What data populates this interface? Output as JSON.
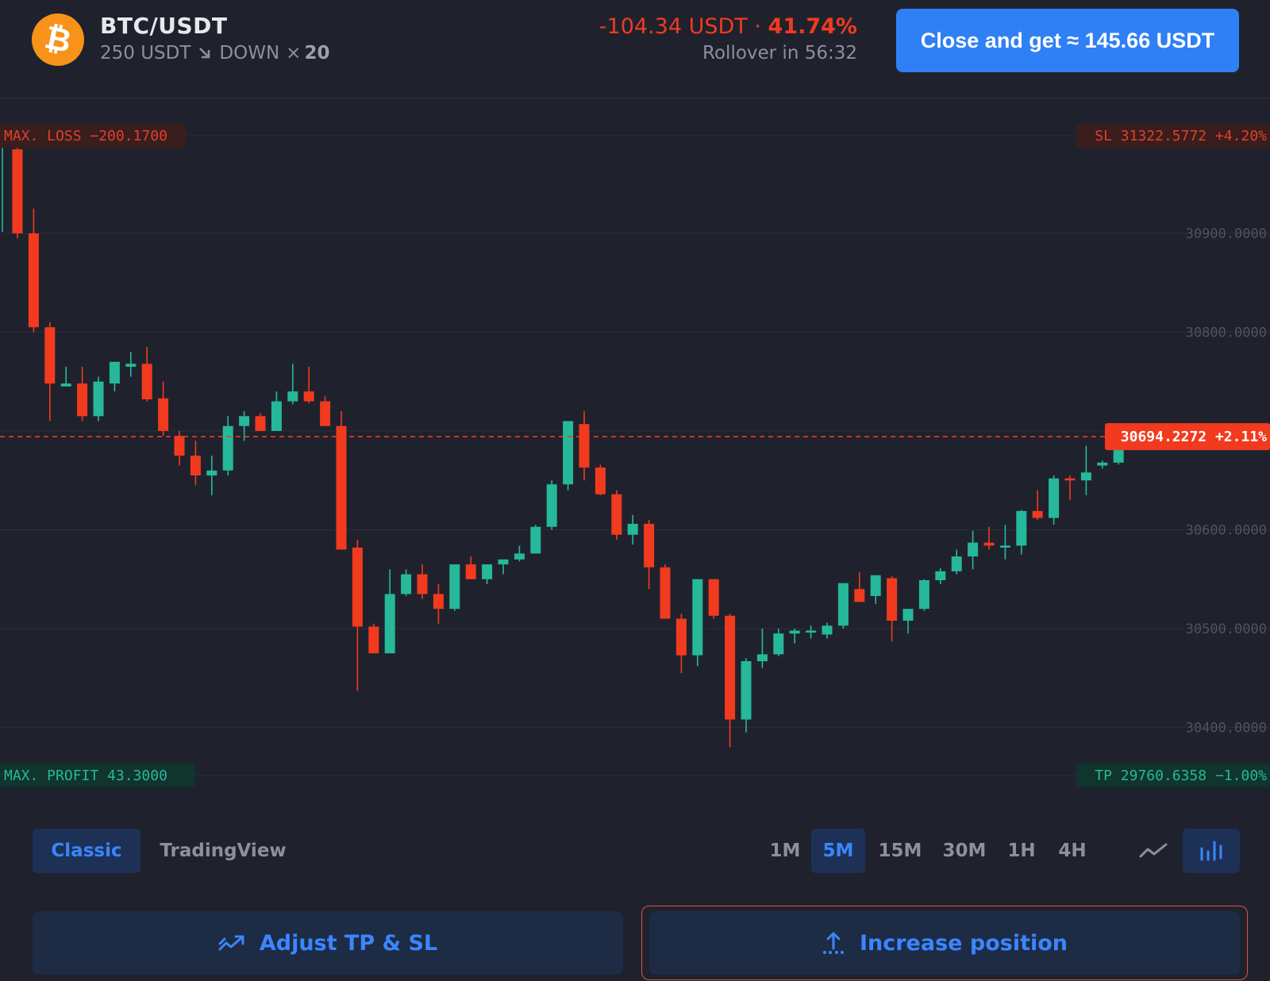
{
  "header": {
    "pair": "BTC/USDT",
    "amount": "250 USDT",
    "direction": "DOWN",
    "multiplier_symbol": "×",
    "multiplier": "20",
    "pnl_value": "-104.34 USDT",
    "pnl_sep": " · ",
    "pnl_percent": "41.74%",
    "rollover": "Rollover in 56:32",
    "close_button": "Close and get ≈ 145.66 USDT",
    "coin_icon": "bitcoin-icon",
    "coin_glyph": "₿"
  },
  "chart_labels": {
    "max_loss": "MAX. LOSS −200.1700",
    "max_profit": "MAX. PROFIT 43.3000",
    "sl": "SL 31322.5772 +4.20%",
    "tp": "TP 29760.6358 −1.00%",
    "current_price": "30694.2272 +2.11%"
  },
  "chart_data": {
    "type": "candlestick",
    "current_price": 30694.2272,
    "yticks": [
      30900,
      30800,
      30600,
      30500,
      30400
    ],
    "ytick_labels": [
      "30900.0000",
      "30800.0000",
      "30600.0000",
      "30500.0000",
      "30400.0000"
    ],
    "ylim": [
      30365,
      31000
    ],
    "candles": [
      [
        30985,
        30990,
        30895,
        30900
      ],
      [
        30900,
        30925,
        30800,
        30805
      ],
      [
        30805,
        30810,
        30710,
        30748
      ],
      [
        30745,
        30765,
        30745,
        30748
      ],
      [
        30748,
        30765,
        30710,
        30715
      ],
      [
        30715,
        30755,
        30710,
        30750
      ],
      [
        30748,
        30770,
        30740,
        30770
      ],
      [
        30765,
        30780,
        30755,
        30768
      ],
      [
        30768,
        30785,
        30730,
        30732
      ],
      [
        30733,
        30750,
        30695,
        30700
      ],
      [
        30695,
        30700,
        30665,
        30675
      ],
      [
        30675,
        30690,
        30645,
        30655
      ],
      [
        30655,
        30675,
        30635,
        30660
      ],
      [
        30660,
        30715,
        30655,
        30705
      ],
      [
        30705,
        30720,
        30690,
        30715
      ],
      [
        30715,
        30718,
        30700,
        30700
      ],
      [
        30700,
        30740,
        30700,
        30730
      ],
      [
        30730,
        30768,
        30727,
        30740
      ],
      [
        30740,
        30765,
        30728,
        30730
      ],
      [
        30730,
        30735,
        30705,
        30705
      ],
      [
        30705,
        30720,
        30580,
        30580
      ],
      [
        30582,
        30590,
        30437,
        30502
      ],
      [
        30502,
        30505,
        30475,
        30475
      ],
      [
        30475,
        30560,
        30475,
        30535
      ],
      [
        30535,
        30560,
        30533,
        30555
      ],
      [
        30555,
        30565,
        30530,
        30535
      ],
      [
        30535,
        30545,
        30505,
        30520
      ],
      [
        30520,
        30565,
        30518,
        30565
      ],
      [
        30565,
        30573,
        30550,
        30550
      ],
      [
        30550,
        30565,
        30545,
        30565
      ],
      [
        30565,
        30570,
        30555,
        30570
      ],
      [
        30570,
        30584,
        30568,
        30576
      ],
      [
        30576,
        30605,
        30576,
        30603
      ],
      [
        30603,
        30650,
        30600,
        30646
      ],
      [
        30646,
        30710,
        30640,
        30710
      ],
      [
        30707,
        30720,
        30650,
        30663
      ],
      [
        30663,
        30666,
        30635,
        30636
      ],
      [
        30636,
        30640,
        30590,
        30595
      ],
      [
        30595,
        30615,
        30585,
        30606
      ],
      [
        30606,
        30610,
        30540,
        30562
      ],
      [
        30562,
        30565,
        30510,
        30510
      ],
      [
        30510,
        30515,
        30455,
        30473
      ],
      [
        30473,
        30550,
        30462,
        30550
      ],
      [
        30550,
        30550,
        30510,
        30513
      ],
      [
        30513,
        30515,
        30380,
        30408
      ],
      [
        30408,
        30470,
        30395,
        30467
      ],
      [
        30467,
        30500,
        30460,
        30474
      ],
      [
        30474,
        30500,
        30472,
        30495
      ],
      [
        30495,
        30500,
        30485,
        30498
      ],
      [
        30498,
        30503,
        30490,
        30498
      ],
      [
        30494,
        30506,
        30490,
        30503
      ],
      [
        30503,
        30545,
        30500,
        30546
      ],
      [
        30540,
        30557,
        30527,
        30527
      ],
      [
        30533,
        30554,
        30525,
        30554
      ],
      [
        30551,
        30553,
        30487,
        30508
      ],
      [
        30508,
        30520,
        30495,
        30520
      ],
      [
        30520,
        30550,
        30518,
        30549
      ],
      [
        30549,
        30561,
        30545,
        30558
      ],
      [
        30558,
        30580,
        30555,
        30573
      ],
      [
        30573,
        30599,
        30560,
        30587
      ],
      [
        30587,
        30603,
        30580,
        30584
      ],
      [
        30584,
        30605,
        30570,
        30584
      ],
      [
        30584,
        30620,
        30575,
        30619
      ],
      [
        30619,
        30640,
        30610,
        30612
      ],
      [
        30612,
        30655,
        30605,
        30652
      ],
      [
        30652,
        30655,
        30630,
        30650
      ],
      [
        30650,
        30685,
        30635,
        30658
      ],
      [
        30665,
        30670,
        30662,
        30668
      ],
      [
        30668,
        30698,
        30666,
        30693
      ]
    ]
  },
  "view_tabs": [
    "Classic",
    "TradingView"
  ],
  "timeframes": [
    "1M",
    "5M",
    "15M",
    "30M",
    "1H",
    "4H"
  ],
  "chart_type_icons": [
    "line-chart-icon",
    "candle-chart-icon"
  ],
  "actions": {
    "adjust": "Adjust TP & SL",
    "increase": "Increase position"
  },
  "colors": {
    "up": "#26b89a",
    "down": "#f23a1e",
    "accent": "#3a86ff",
    "background": "#1f222d"
  }
}
